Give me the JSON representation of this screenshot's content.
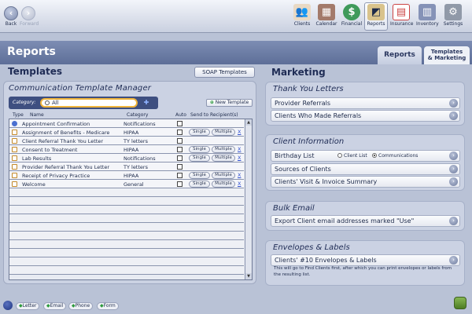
{
  "nav": {
    "back": "Back",
    "forward": "Forward"
  },
  "modules": [
    {
      "label": "Clients",
      "icon": "clients-icon",
      "glyph": "👥"
    },
    {
      "label": "Calendar",
      "icon": "calendar-icon",
      "glyph": "▦"
    },
    {
      "label": "Financial",
      "icon": "financial-icon",
      "glyph": "$"
    },
    {
      "label": "Reports",
      "icon": "reports-icon",
      "glyph": "◩"
    },
    {
      "label": "Insurance",
      "icon": "insurance-icon",
      "glyph": "▤"
    },
    {
      "label": "Inventory",
      "icon": "inventory-icon",
      "glyph": "▥"
    },
    {
      "label": "Settings",
      "icon": "settings-icon",
      "glyph": "⚙"
    }
  ],
  "page": {
    "title": "Reports",
    "tabs": {
      "reports": "Reports",
      "marketing_line1": "Templates",
      "marketing_line2": "& Marketing"
    }
  },
  "templates": {
    "title": "Templates",
    "soap_button": "SOAP Templates",
    "manager": {
      "title": "Communication Template Manager",
      "category_label": "Category:",
      "category_value": "All",
      "new_template": "New Template",
      "columns": {
        "type": "Type",
        "name": "Name",
        "category": "Category",
        "auto": "Auto",
        "send_to": "Send to Recipient(s)"
      },
      "rows": [
        {
          "type": "email",
          "name": "Appointment Confirmation",
          "category": "Notifications",
          "auto": true,
          "single": false
        },
        {
          "type": "letter",
          "name": "Assignment of Benefits - Medicare",
          "category": "HIPAA",
          "auto": false,
          "single": true
        },
        {
          "type": "letter",
          "name": "Client Referral Thank You Letter",
          "category": "TY letters",
          "auto": false,
          "single": false
        },
        {
          "type": "letter",
          "name": "Consent to Treatment",
          "category": "HIPAA",
          "auto": false,
          "single": true
        },
        {
          "type": "letter",
          "name": "Lab Results",
          "category": "Notifications",
          "auto": false,
          "single": true
        },
        {
          "type": "letter",
          "name": "Provider Referral Thank You Letter",
          "category": "TY letters",
          "auto": false,
          "single": false
        },
        {
          "type": "letter",
          "name": "Receipt of Privacy Practice",
          "category": "HIPAA",
          "auto": false,
          "single": true
        },
        {
          "type": "letter",
          "name": "Welcome",
          "category": "General",
          "auto": false,
          "single": true
        }
      ],
      "single_label": "Single",
      "multiple_label": "Multiple",
      "remove_label": "X"
    }
  },
  "marketing": {
    "title": "Marketing",
    "thank_you": {
      "title": "Thank You Letters",
      "items": [
        "Provider Referrals",
        "Clients Who Made Referrals"
      ]
    },
    "client_info": {
      "title": "Client Information",
      "birthday": "Birthday List",
      "opt_client_list": "Client List",
      "opt_communications": "Communications",
      "items": [
        "Sources of Clients",
        "Clients' Visit & Invoice Summary"
      ]
    },
    "bulk_email": {
      "title": "Bulk Email",
      "item": "Export Client email addresses marked \"Use\""
    },
    "envelopes": {
      "title": "Envelopes & Labels",
      "item": "Clients' #10 Envelopes & Labels",
      "note": "This will go to Find Clients first, after which you can print envelopes or labels from the resulting list."
    }
  },
  "legend": [
    "Letter",
    "Email",
    "Phone",
    "Form"
  ]
}
